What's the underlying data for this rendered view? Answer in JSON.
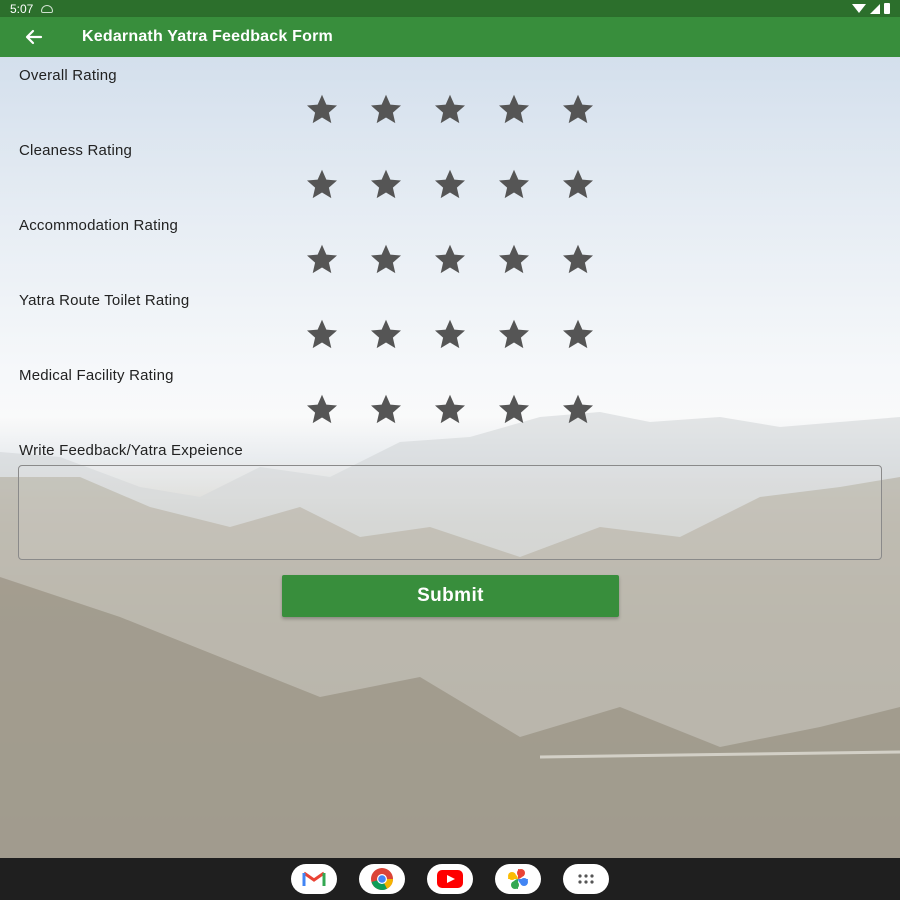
{
  "status_bar": {
    "time": "5:07"
  },
  "app_bar": {
    "title": "Kedarnath Yatra Feedback Form"
  },
  "ratings": [
    {
      "label": "Overall Rating",
      "value": 0,
      "max": 5
    },
    {
      "label": "Cleaness Rating",
      "value": 0,
      "max": 5
    },
    {
      "label": "Accommodation Rating",
      "value": 0,
      "max": 5
    },
    {
      "label": "Yatra Route Toilet Rating",
      "value": 0,
      "max": 5
    },
    {
      "label": "Medical Facility Rating",
      "value": 0,
      "max": 5
    }
  ],
  "feedback": {
    "label": "Write Feedback/Yatra Expeience",
    "value": ""
  },
  "submit": {
    "label": "Submit"
  },
  "colors": {
    "primary": "#388e3c",
    "status_bar": "#2c6f2c",
    "star_empty": "#555555",
    "nav_bar": "#1f1f1f"
  },
  "dock": [
    "gmail-icon",
    "chrome-icon",
    "youtube-icon",
    "photos-icon",
    "app-drawer-icon"
  ]
}
